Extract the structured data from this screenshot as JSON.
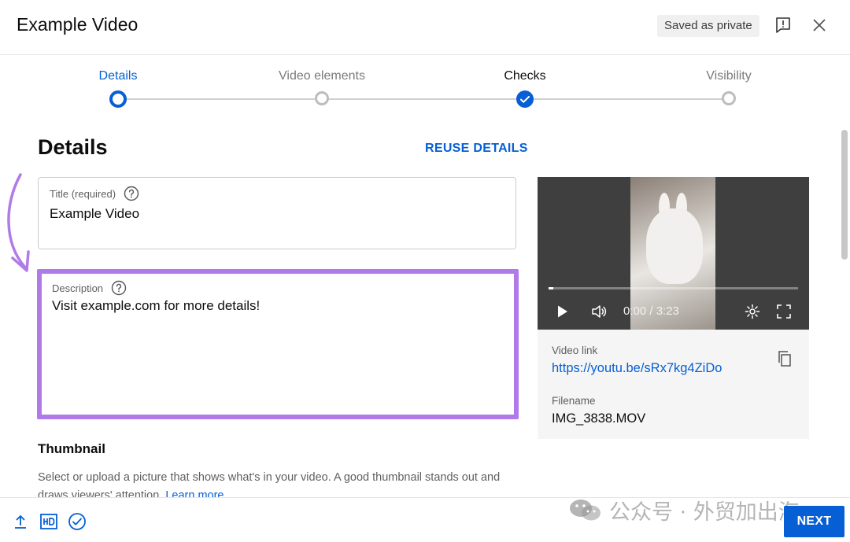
{
  "header": {
    "title": "Example Video",
    "saved_badge": "Saved as private",
    "report_icon": "feedback-icon",
    "close_icon": "close-icon"
  },
  "stepper": {
    "steps": [
      {
        "label": "Details",
        "state": "active"
      },
      {
        "label": "Video elements",
        "state": "pending"
      },
      {
        "label": "Checks",
        "state": "done"
      },
      {
        "label": "Visibility",
        "state": "pending"
      }
    ]
  },
  "details": {
    "heading": "Details",
    "reuse_label": "REUSE DETAILS",
    "title_field": {
      "label": "Title (required)",
      "value": "Example Video"
    },
    "description_field": {
      "label": "Description",
      "value": "Visit example.com for more details!"
    },
    "highlight_color": "#b07be8"
  },
  "thumbnail": {
    "heading": "Thumbnail",
    "text": "Select or upload a picture that shows what's in your video. A good thumbnail stands out and draws viewers' attention.",
    "learn_more": "Learn more"
  },
  "video": {
    "time": "0:00 / 3:23",
    "progress_fraction": 0.02,
    "link_label": "Video link",
    "link": "https://youtu.be/sRx7kg4ZiDo",
    "filename_label": "Filename",
    "filename": "IMG_3838.MOV"
  },
  "footer": {
    "icons": [
      "upload-icon",
      "hd-icon",
      "check-circle-icon"
    ],
    "watermark": "公众号 · 外贸加出海",
    "next_label": "NEXT"
  },
  "colors": {
    "accent": "#065fd4",
    "highlight": "#b07be8"
  }
}
